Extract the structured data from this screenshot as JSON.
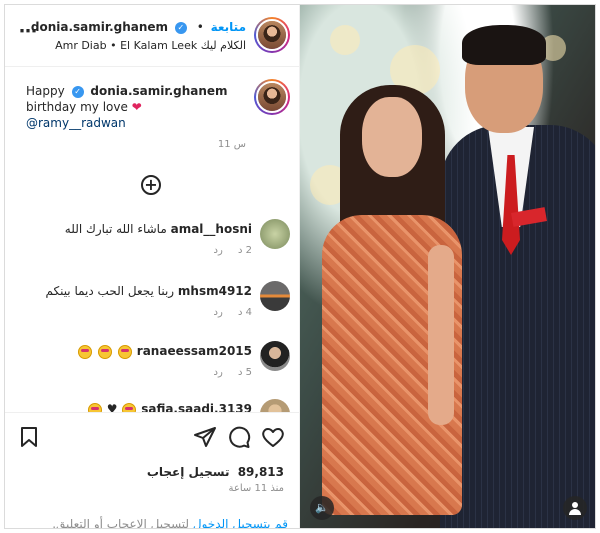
{
  "header": {
    "follow_label": "متابعة",
    "dot": "•",
    "username": "donia.samir.ghanem",
    "audio_artist": "Amr Diab",
    "audio_sep": "•",
    "audio_title": "El Kalam Leek الكلام ليك",
    "more_icon": "⋯"
  },
  "caption": {
    "prefix": "Happy",
    "username": "donia.samir.ghanem",
    "text": "birthday my love",
    "heart": "❤",
    "mention": "@ramy__radwan",
    "time": "11 س"
  },
  "add_comment_icon": "+",
  "comments": [
    {
      "username": "amal__hosni",
      "text": "ماشاء الله تبارك الله",
      "age": "2 د",
      "reply": "رد",
      "emojis": 0,
      "avatar": "av1"
    },
    {
      "username": "mhsm4912",
      "text": "ربنا يجعل الحب ديما بينكم",
      "age": "4 د",
      "reply": "رد",
      "emojis": 0,
      "avatar": "av2"
    },
    {
      "username": "ranaeessam2015",
      "text": "",
      "age": "5 د",
      "reply": "رد",
      "emojis": 3,
      "avatar": "av3"
    },
    {
      "username": "safia.saadi.3139",
      "text": "♥",
      "age": "",
      "reply": "",
      "emojis": 2,
      "avatar": "av4"
    }
  ],
  "actions": {
    "likes_count": "89,813",
    "likes_label": "تسجيل إعجاب",
    "ago": "منذ 11 ساعة"
  },
  "login": {
    "link": "قم بتسجيل الدخول",
    "rest": "لتسجيل الإعجاب أو التعليق."
  },
  "photo": {
    "sound_icon": "🔈"
  },
  "colors": {
    "link_blue": "#0095f6",
    "verified_blue": "#3897f0",
    "heart_red": "#e0245e",
    "border": "#dbdbdb",
    "muted": "#8e8e8e"
  }
}
